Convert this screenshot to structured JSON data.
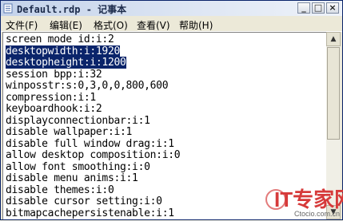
{
  "window": {
    "title": "Default.rdp - 记事本"
  },
  "titlebar_buttons": {
    "minimize": "_",
    "maximize": "□",
    "close": "×"
  },
  "menu": [
    "文件(F)",
    "编辑(E)",
    "格式(O)",
    "查看(V)",
    "帮助(H)"
  ],
  "lines": [
    {
      "text": "screen mode id:i:2",
      "selected": false
    },
    {
      "text": "desktopwidth:i:1920",
      "selected": true
    },
    {
      "text": "desktopheight:i:1200",
      "selected": true
    },
    {
      "text": "session bpp:i:32",
      "selected": false
    },
    {
      "text": "winposstr:s:0,3,0,0,800,600",
      "selected": false
    },
    {
      "text": "compression:i:1",
      "selected": false
    },
    {
      "text": "keyboardhook:i:2",
      "selected": false
    },
    {
      "text": "displayconnectionbar:i:1",
      "selected": false
    },
    {
      "text": "disable wallpaper:i:1",
      "selected": false
    },
    {
      "text": "disable full window drag:i:1",
      "selected": false
    },
    {
      "text": "allow desktop composition:i:0",
      "selected": false
    },
    {
      "text": "allow font smoothing:i:0",
      "selected": false
    },
    {
      "text": "disable menu anims:i:1",
      "selected": false
    },
    {
      "text": "disable themes:i:0",
      "selected": false
    },
    {
      "text": "disable cursor setting:i:0",
      "selected": false
    },
    {
      "text": "bitmapcachepersistenable:i:1",
      "selected": false
    }
  ],
  "watermark": {
    "logo_text": "IT专家网",
    "site": "Ctocio.com.cn"
  },
  "colors": {
    "selection": "#0a246a",
    "logo": "#d63a3a"
  }
}
